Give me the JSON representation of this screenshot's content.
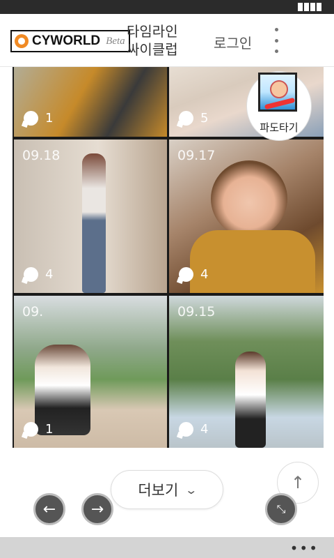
{
  "header": {
    "logo_text": "CYWORLD",
    "logo_beta": "Beta",
    "timeline_cycle": "타임라인\n싸이클럽",
    "login": "로그인",
    "menu_icon": "kebab-menu-icon"
  },
  "floating": {
    "padotagi_label": "파도타기"
  },
  "photos": [
    {
      "date": "",
      "comments": "1",
      "colors": [
        "#c68a2a",
        "#6e5a3a"
      ]
    },
    {
      "date": "",
      "comments": "5",
      "colors": [
        "#d9cbbd",
        "#8aa0b8"
      ]
    },
    {
      "date": "09.18",
      "comments": "4",
      "colors": [
        "#b8a48f",
        "#5c6f8b"
      ]
    },
    {
      "date": "09.17",
      "comments": "4",
      "colors": [
        "#6e4a2e",
        "#c8902f"
      ]
    },
    {
      "date": "09.",
      "comments": "1",
      "colors": [
        "#8fa88a",
        "#c9b9a6"
      ]
    },
    {
      "date": "09.15",
      "comments": "4",
      "colors": [
        "#6f8f5a",
        "#c8d7e3"
      ]
    }
  ],
  "more": {
    "label": "더보기",
    "chevron_icon": "chevron-down-icon"
  },
  "controls": {
    "back_icon": "arrow-left-icon",
    "forward_icon": "arrow-right-icon",
    "shrink_icon": "collapse-icon",
    "top_icon": "arrow-up-icon"
  },
  "bottom": {
    "overflow": "•••"
  }
}
